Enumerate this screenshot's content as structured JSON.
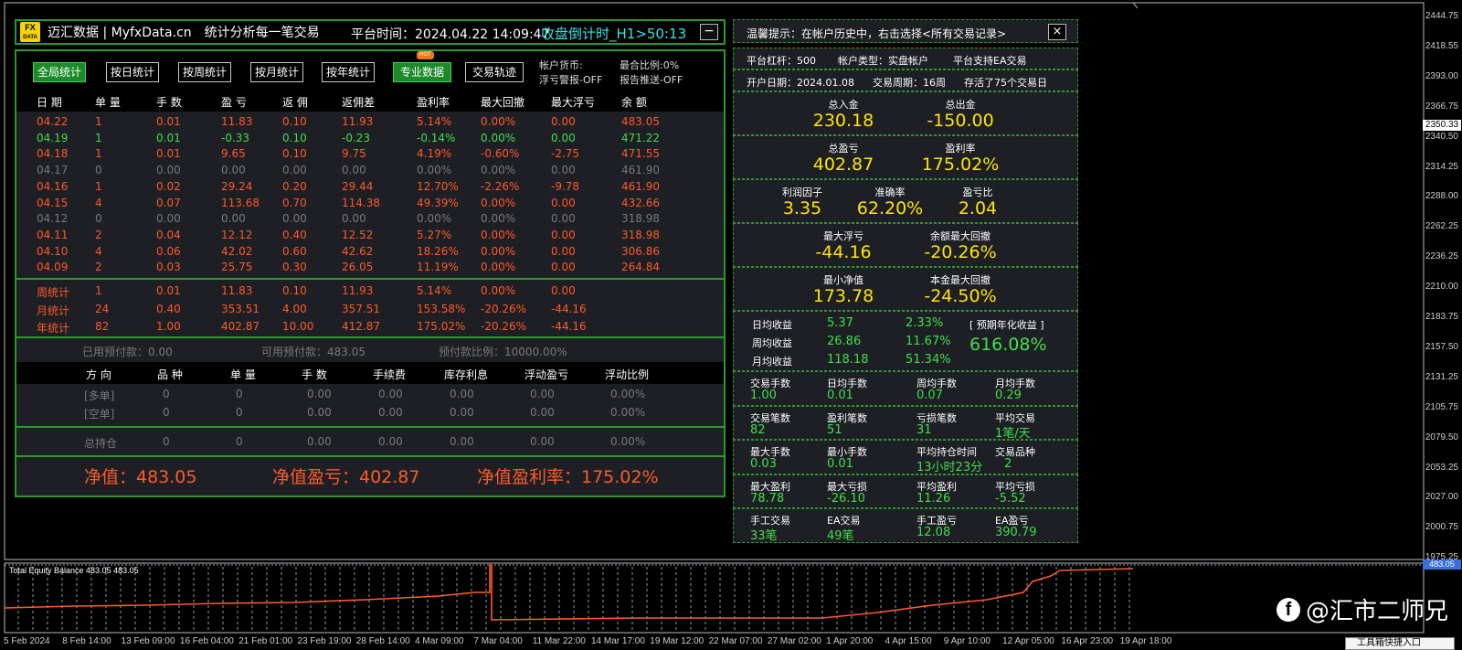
{
  "header": {
    "logo_top": "FX",
    "logo_bottom": "DATA",
    "title": "迈汇数据 | MyfxData.cn",
    "slogan": "统计分析每一笔交易",
    "platform_time": "平台时间：2024.04.22 14:09:47",
    "countdown": "收盘倒计时_H1>50:13",
    "minimize": "−"
  },
  "tabs": [
    {
      "label": "全局统计",
      "active": true
    },
    {
      "label": "按日统计",
      "active": false
    },
    {
      "label": "按周统计",
      "active": false
    },
    {
      "label": "按月统计",
      "active": false
    },
    {
      "label": "按年统计",
      "active": false
    },
    {
      "label": "专业数据",
      "active": true
    },
    {
      "label": "交易轨迹",
      "active": false
    }
  ],
  "hot_badge": "HOT",
  "account_info": {
    "currency": "帐户货币:",
    "margin_ratio": "最合比例:0%",
    "float_warning": "浮亏警报-OFF",
    "report_push": "报告推送-OFF"
  },
  "daily_table": {
    "headers": [
      "日 期",
      "单 量",
      "手 数",
      "盈 亏",
      "返 佣",
      "返佣差",
      "盈利率",
      "最大回撤",
      "最大浮亏",
      "余 额"
    ],
    "rows": [
      {
        "c": [
          "04.22",
          "1",
          "0.01",
          "11.83",
          "0.10",
          "11.93",
          "5.14%",
          "0.00%",
          "0.00",
          "483.05"
        ],
        "color": "red"
      },
      {
        "c": [
          "04.19",
          "1",
          "0.01",
          "-0.33",
          "0.10",
          "-0.23",
          "-0.14%",
          "0.00%",
          "0.00",
          "471.22"
        ],
        "color": "green"
      },
      {
        "c": [
          "04.18",
          "1",
          "0.01",
          "9.65",
          "0.10",
          "9.75",
          "4.19%",
          "-0.60%",
          "-2.75",
          "471.55"
        ],
        "color": "red"
      },
      {
        "c": [
          "04.17",
          "0",
          "0.00",
          "0.00",
          "0.00",
          "0.00",
          "0.00%",
          "0.00%",
          "0.00",
          "461.90"
        ],
        "color": "gray"
      },
      {
        "c": [
          "04.16",
          "1",
          "0.02",
          "29.24",
          "0.20",
          "29.44",
          "12.70%",
          "-2.26%",
          "-9.78",
          "461.90"
        ],
        "color": "red"
      },
      {
        "c": [
          "04.15",
          "4",
          "0.07",
          "113.68",
          "0.70",
          "114.38",
          "49.39%",
          "0.00%",
          "0.00",
          "432.66"
        ],
        "color": "red"
      },
      {
        "c": [
          "04.12",
          "0",
          "0.00",
          "0.00",
          "0.00",
          "0.00",
          "0.00%",
          "0.00%",
          "0.00",
          "318.98"
        ],
        "color": "gray"
      },
      {
        "c": [
          "04.11",
          "2",
          "0.04",
          "12.12",
          "0.40",
          "12.52",
          "5.27%",
          "0.00%",
          "0.00",
          "318.98"
        ],
        "color": "red"
      },
      {
        "c": [
          "04.10",
          "4",
          "0.06",
          "42.02",
          "0.60",
          "42.62",
          "18.26%",
          "0.00%",
          "0.00",
          "306.86"
        ],
        "color": "red"
      },
      {
        "c": [
          "04.09",
          "2",
          "0.03",
          "25.75",
          "0.30",
          "26.05",
          "11.19%",
          "0.00%",
          "0.00",
          "264.84"
        ],
        "color": "red"
      }
    ]
  },
  "summary_rows": [
    {
      "c": [
        "周统计",
        "1",
        "0.01",
        "11.83",
        "0.10",
        "11.93",
        "5.14%",
        "0.00%",
        "0.00"
      ]
    },
    {
      "c": [
        "月统计",
        "24",
        "0.40",
        "353.51",
        "4.00",
        "357.51",
        "153.58%",
        "-20.26%",
        "-44.16"
      ]
    },
    {
      "c": [
        "年统计",
        "82",
        "1.00",
        "402.87",
        "10.00",
        "412.87",
        "175.02%",
        "-20.26%",
        "-44.16"
      ]
    }
  ],
  "margin_info": {
    "used": "已用预付款：0.00",
    "available": "可用预付款：483.05",
    "ratio": "预付款比例：10000.00%"
  },
  "position_table": {
    "headers": [
      "方 向",
      "品 种",
      "单 量",
      "手 数",
      "手续费",
      "库存利息",
      "浮动盈亏",
      "浮动比例"
    ],
    "rows": [
      {
        "c": [
          "[多单]",
          "0",
          "0",
          "0.00",
          "0.00",
          "0.00",
          "0.00",
          "0.00%"
        ]
      },
      {
        "c": [
          "[空单]",
          "0",
          "0",
          "0.00",
          "0.00",
          "0.00",
          "0.00",
          "0.00%"
        ]
      }
    ],
    "total": {
      "c": [
        "总持仓",
        "0",
        "0",
        "0.00",
        "0.00",
        "0.00",
        "0.00",
        "0.00%"
      ]
    }
  },
  "footer": {
    "equity": "净值：483.05",
    "equity_pl": "净值盈亏：402.87",
    "equity_rate": "净值盈利率：175.02%"
  },
  "right": {
    "tip": "温馨提示：在帐户历史中，右击选择<所有交易记录>",
    "close": "×",
    "leverage": "平台杠杆：500",
    "account_type": "帐户类型：实盘帐户",
    "ea_support": "平台支持EA交易",
    "open_date": "开户日期：2024.01.08",
    "trade_period": "交易周期：16周",
    "days_stored": "存活了75个交易日",
    "deposit_label": "总入金",
    "deposit": "230.18",
    "withdraw_label": "总出金",
    "withdraw": "-150.00",
    "total_pl_label": "总盈亏",
    "total_pl": "402.87",
    "profit_rate_label": "盈利率",
    "profit_rate": "175.02%",
    "profit_factor_label": "利润因子",
    "profit_factor": "3.35",
    "accuracy_label": "准确率",
    "accuracy": "62.20%",
    "pl_ratio_label": "盈亏比",
    "pl_ratio": "2.04",
    "max_float_label": "最大浮亏",
    "max_float": "-44.16",
    "bal_dd_label": "余额最大回撤",
    "bal_dd": "-20.26%",
    "min_equity_label": "最小净值",
    "min_equity": "173.78",
    "principal_dd_label": "本金最大回撤",
    "principal_dd": "-24.50%",
    "daily_label": "日均收益",
    "daily_val": "5.37",
    "daily_pct": "2.33%",
    "weekly_label": "周均收益",
    "weekly_val": "26.86",
    "weekly_pct": "11.67%",
    "monthly_label": "月均收益",
    "monthly_val": "118.18",
    "monthly_pct": "51.34%",
    "annual_label": "[ 预期年化收益 ]",
    "annual": "616.08%",
    "grid": [
      [
        {
          "l": "交易手数",
          "v": "1.00"
        },
        {
          "l": "日均手数",
          "v": "0.01"
        },
        {
          "l": "周均手数",
          "v": "0.07"
        },
        {
          "l": "月均手数",
          "v": "0.29"
        }
      ],
      [
        {
          "l": "交易笔数",
          "v": "82"
        },
        {
          "l": "盈利笔数",
          "v": "51"
        },
        {
          "l": "亏损笔数",
          "v": "31"
        },
        {
          "l": "平均交易",
          "v": "1笔/天"
        }
      ],
      [
        {
          "l": "最大手数",
          "v": "0.03"
        },
        {
          "l": "最小手数",
          "v": "0.01"
        },
        {
          "l": "平均持仓时间",
          "v": "13小时23分"
        },
        {
          "l": "交易品种",
          "v": "2"
        }
      ],
      [
        {
          "l": "最大盈利",
          "v": "78.78"
        },
        {
          "l": "最大亏损",
          "v": "-26.10"
        },
        {
          "l": "平均盈利",
          "v": "11.26"
        },
        {
          "l": "平均亏损",
          "v": "-5.52"
        }
      ],
      [
        {
          "l": "手工交易",
          "v": "33笔"
        },
        {
          "l": "EA交易",
          "v": "49笔"
        },
        {
          "l": "手工盈亏",
          "v": "12.08"
        },
        {
          "l": "EA盈亏",
          "v": "390.79"
        }
      ]
    ]
  },
  "price_axis": [
    "2444.75",
    "2418.55",
    "2393.00",
    "2366.75",
    "2340.50",
    "2314.25",
    "2288.00",
    "2262.25",
    "2236.25",
    "2210.00",
    "2183.75",
    "2157.50",
    "2131.25",
    "2105.75",
    "2079.50",
    "2053.25",
    "2027.00",
    "2000.75",
    "1975.25"
  ],
  "current_price": "2350.33",
  "equity_indicator": {
    "label": "Total Equity Balance 483.05 483.05",
    "value": "483.05"
  },
  "time_axis": [
    "5 Feb 2024",
    "8 Feb 14:00",
    "13 Feb 09:00",
    "16 Feb 04:00",
    "21 Feb 01:00",
    "23 Feb 19:00",
    "28 Feb 14:00",
    "4 Mar 09:00",
    "7 Mar 04:00",
    "11 Mar 22:00",
    "14 Mar 17:00",
    "19 Mar 12:00",
    "22 Mar 07:00",
    "27 Mar 02:00",
    "1 Apr 20:00",
    "4 Apr 15:00",
    "9 Apr 10:00",
    "12 Apr 05:00",
    "16 Apr 23:00",
    "19 Apr 18:00"
  ],
  "watermark": "@汇市二师兄",
  "shortcut": "工具箱快捷入口"
}
